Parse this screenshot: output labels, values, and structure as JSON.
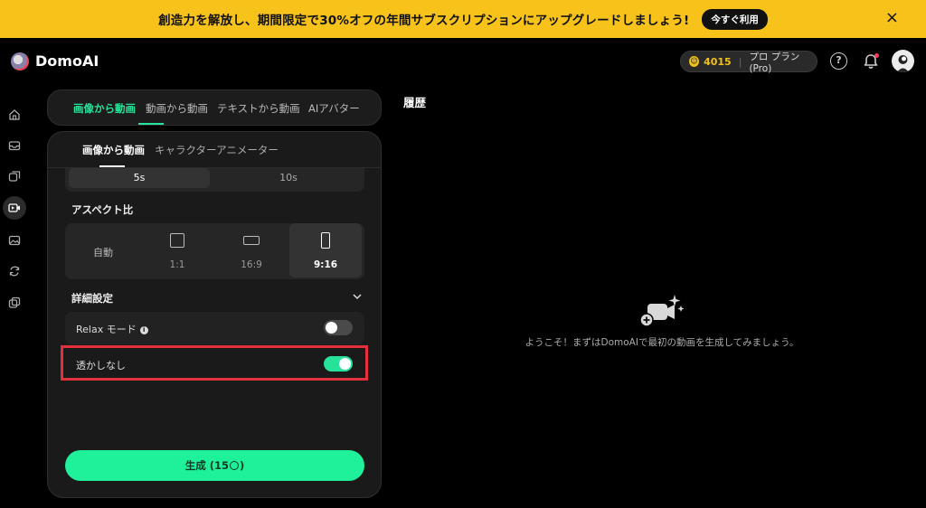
{
  "banner": {
    "text": "創造力を解放し、期間限定で30%オフの年間サブスクリプションにアップグレードしましょう!",
    "cta": "今すぐ利用",
    "close": "×"
  },
  "header": {
    "app_name": "DomoAI",
    "credits": "4015",
    "plan": "プロ プラン(Pro)",
    "help": "?"
  },
  "mode_tabs": [
    {
      "label": "画像から動画",
      "active": true
    },
    {
      "label": "動画から動画",
      "active": false
    },
    {
      "label": "テキストから動画",
      "active": false
    },
    {
      "label": "AIアバター",
      "active": false
    }
  ],
  "sub_tabs": [
    {
      "label": "画像から動画",
      "active": true
    },
    {
      "label": "キャラクターアニメーター",
      "active": false
    }
  ],
  "duration": {
    "options": [
      "5s",
      "10s"
    ],
    "selected": "5s"
  },
  "aspect": {
    "label": "アスペクト比",
    "options": [
      {
        "label": "自動"
      },
      {
        "label": "1:1"
      },
      {
        "label": "16:9"
      },
      {
        "label": "9:16"
      }
    ],
    "selected": "9:16"
  },
  "advanced": {
    "label": "詳細設定",
    "relax_label": "Relax モード",
    "relax_on": false,
    "watermark_label": "透かしなし",
    "watermark_on": true
  },
  "generate": {
    "label_prefix": "生成 (15",
    "label_suffix": ")"
  },
  "history": {
    "title": "履歴",
    "empty_text": "ようこそ！まずはDomoAIで最初の動画を生成してみましょう。"
  },
  "colors": {
    "accent": "#27e29a",
    "banner": "#f7c21a",
    "highlight": "#e2313d"
  }
}
